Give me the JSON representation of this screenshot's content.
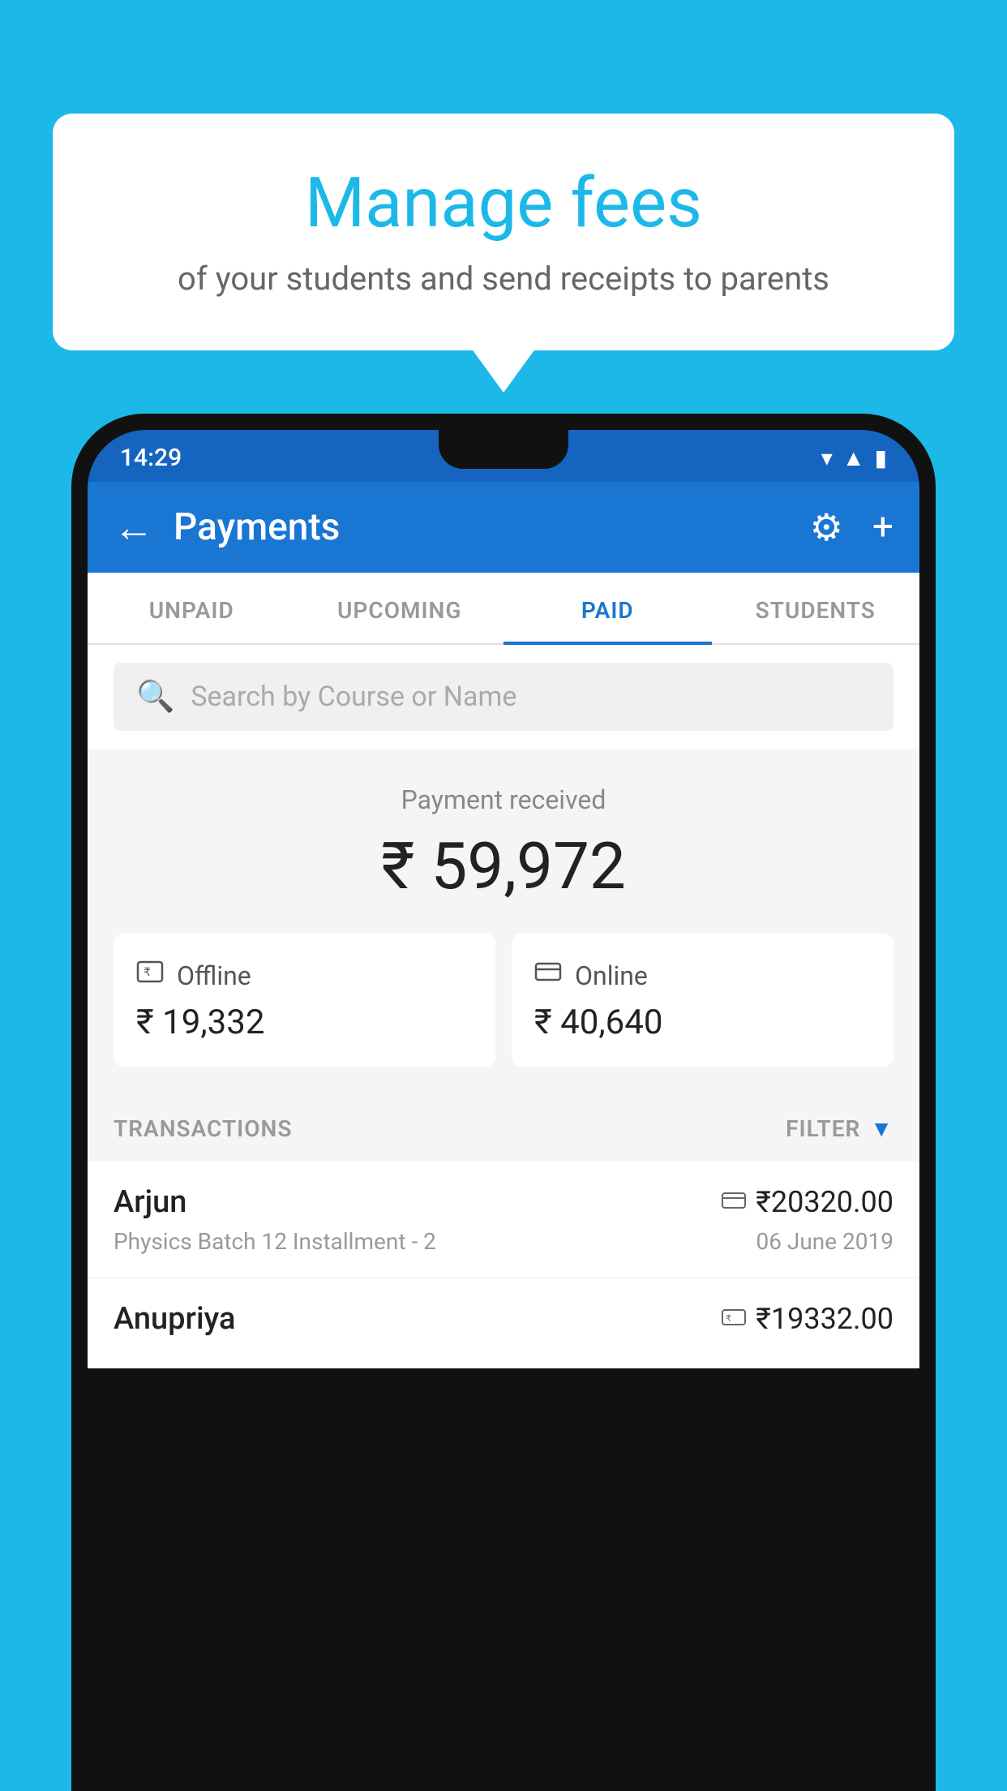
{
  "page": {
    "background_color": "#1BB8E8"
  },
  "speech_bubble": {
    "title": "Manage fees",
    "subtitle": "of your students and send receipts to parents"
  },
  "status_bar": {
    "time": "14:29",
    "wifi_icon": "▼",
    "signal_icon": "◀",
    "battery_icon": "▮"
  },
  "app_bar": {
    "title": "Payments",
    "back_label": "←",
    "gear_label": "⚙",
    "add_label": "+"
  },
  "tabs": [
    {
      "label": "UNPAID",
      "active": false
    },
    {
      "label": "UPCOMING",
      "active": false
    },
    {
      "label": "PAID",
      "active": true
    },
    {
      "label": "STUDENTS",
      "active": false
    }
  ],
  "search": {
    "placeholder": "Search by Course or Name"
  },
  "payment_received": {
    "label": "Payment received",
    "amount": "₹ 59,972"
  },
  "payment_cards": [
    {
      "label": "Offline",
      "amount": "₹ 19,332",
      "icon": "💳"
    },
    {
      "label": "Online",
      "amount": "₹ 40,640",
      "icon": "💳"
    }
  ],
  "transactions_section": {
    "label": "TRANSACTIONS",
    "filter_label": "FILTER"
  },
  "transactions": [
    {
      "name": "Arjun",
      "detail": "Physics Batch 12 Installment - 2",
      "amount": "₹20320.00",
      "date": "06 June 2019",
      "type_icon": "💳"
    },
    {
      "name": "Anupriya",
      "detail": "",
      "amount": "₹19332.00",
      "date": "",
      "type_icon": "₹"
    }
  ]
}
